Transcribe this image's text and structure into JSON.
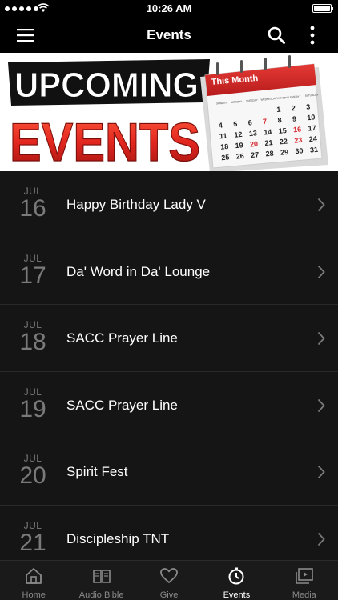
{
  "status_bar": {
    "time": "10:26 AM"
  },
  "nav": {
    "title": "Events"
  },
  "banner": {
    "line1": "UPCOMING",
    "line2": "EVENTS",
    "calendar_header": "This Month",
    "calendar_weekdays": [
      "SUNDAY",
      "MONDAY",
      "TUESDAY",
      "WEDNESDAY",
      "THURSDAY",
      "FRIDAY",
      "SATURDAY"
    ],
    "calendar_days": [
      "1",
      "2",
      "3",
      "4",
      "5",
      "6",
      "7",
      "8",
      "9",
      "10",
      "11",
      "12",
      "13",
      "14",
      "15",
      "16",
      "17",
      "18",
      "19",
      "20",
      "21",
      "22",
      "23",
      "24",
      "25",
      "26",
      "27",
      "28",
      "29",
      "30",
      "31"
    ]
  },
  "events": [
    {
      "month": "JUL",
      "day": "16",
      "title": "Happy Birthday Lady V"
    },
    {
      "month": "JUL",
      "day": "17",
      "title": "Da' Word in Da' Lounge"
    },
    {
      "month": "JUL",
      "day": "18",
      "title": "SACC Prayer Line"
    },
    {
      "month": "JUL",
      "day": "19",
      "title": "SACC Prayer Line"
    },
    {
      "month": "JUL",
      "day": "20",
      "title": "Spirit Fest"
    },
    {
      "month": "JUL",
      "day": "21",
      "title": "Discipleship TNT"
    }
  ],
  "tabs": [
    {
      "label": "Home",
      "icon": "home-icon"
    },
    {
      "label": "Audio Bible",
      "icon": "book-icon"
    },
    {
      "label": "Give",
      "icon": "heart-icon"
    },
    {
      "label": "Events",
      "icon": "clock-icon",
      "active": true
    },
    {
      "label": "Media",
      "icon": "media-icon"
    }
  ],
  "colors": {
    "accent": "#d7262e",
    "background": "#141414",
    "bar": "#000000"
  }
}
